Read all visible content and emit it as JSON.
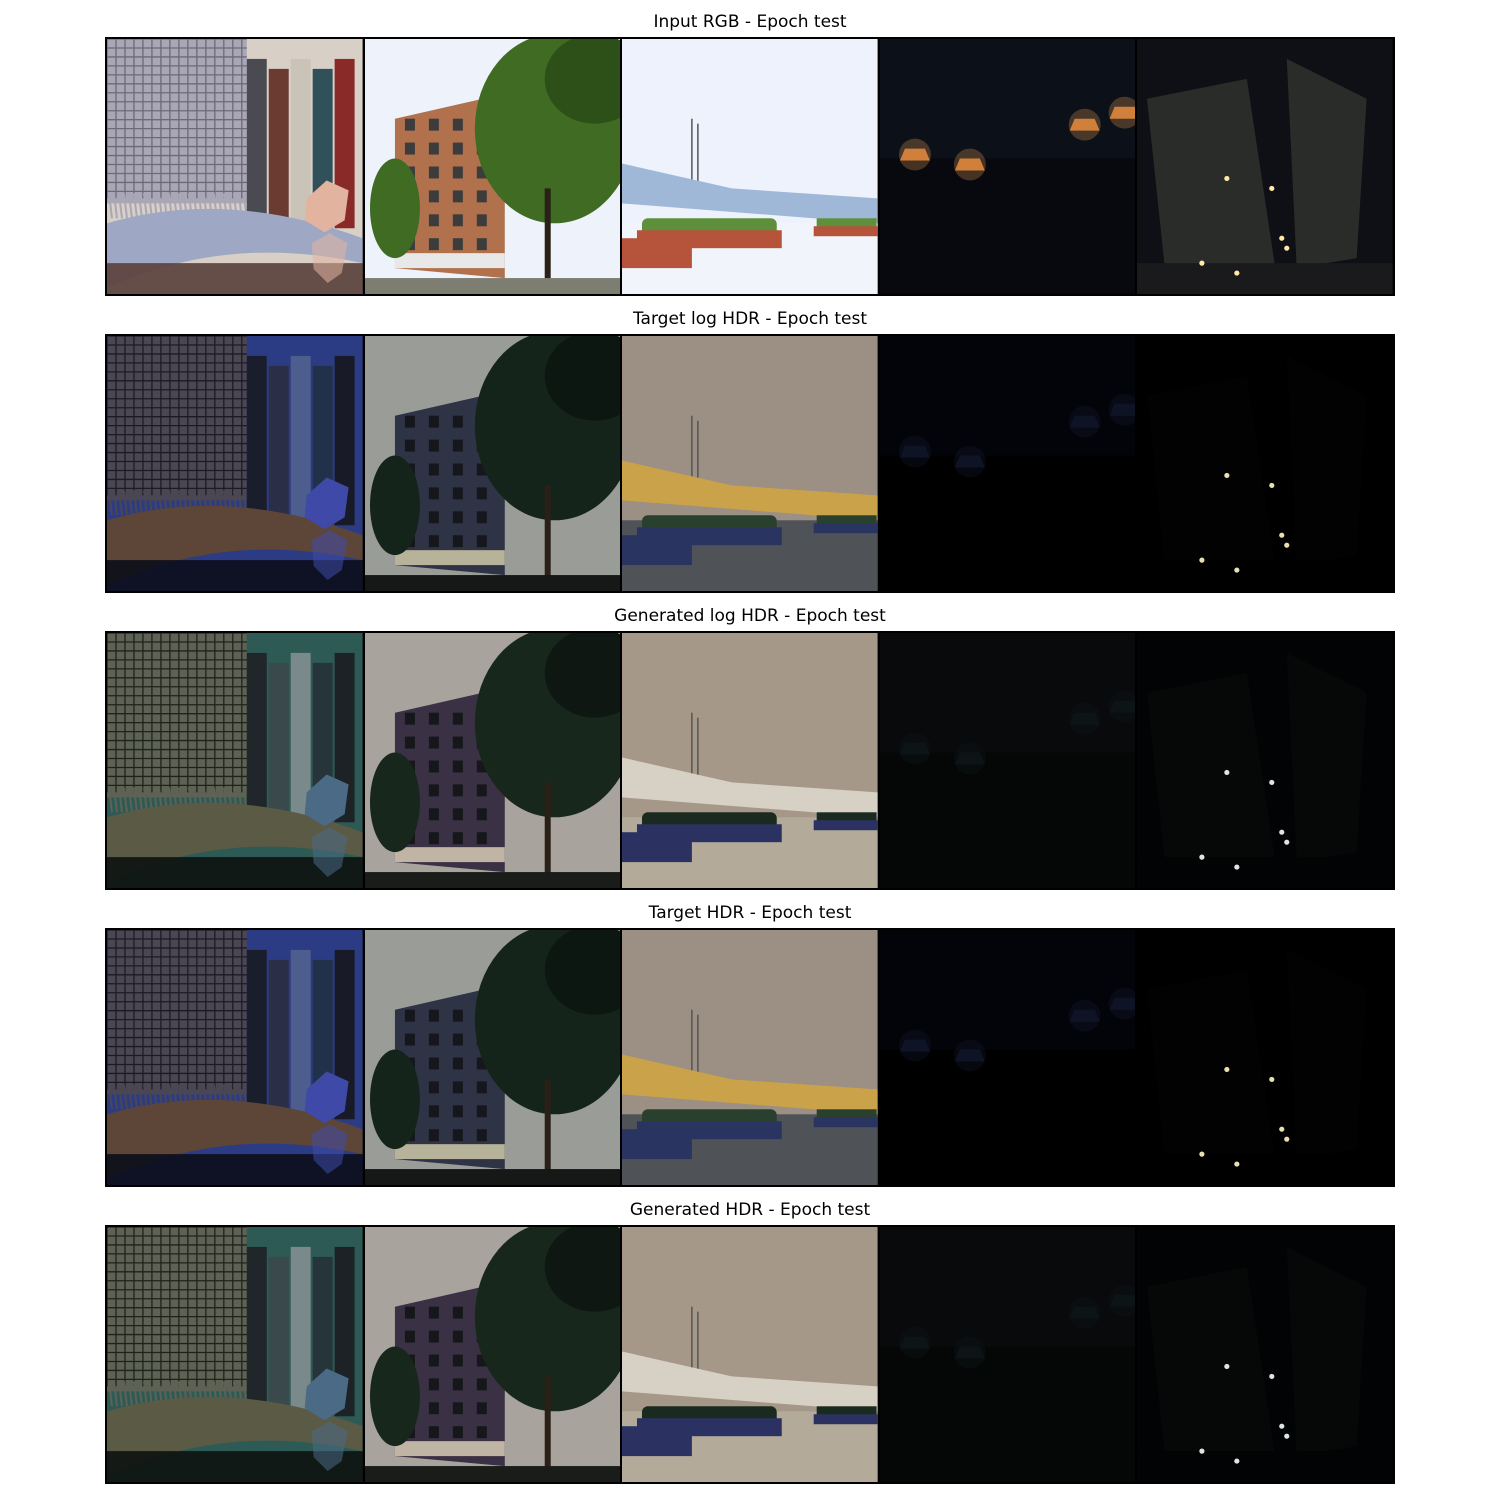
{
  "figure": {
    "rows": [
      {
        "title": "Input RGB - Epoch test",
        "variant": "input"
      },
      {
        "title": "Target log HDR - Epoch test",
        "variant": "target"
      },
      {
        "title": "Generated log HDR - Epoch test",
        "variant": "generated"
      },
      {
        "title": "Target HDR - Epoch test",
        "variant": "target"
      },
      {
        "title": "Generated HDR - Epoch test",
        "variant": "generated"
      }
    ],
    "scenes": [
      "rug-and-books",
      "brick-building-with-trees",
      "stadium-plaza",
      "night-hanging-lamps",
      "night-glass-structure"
    ]
  }
}
